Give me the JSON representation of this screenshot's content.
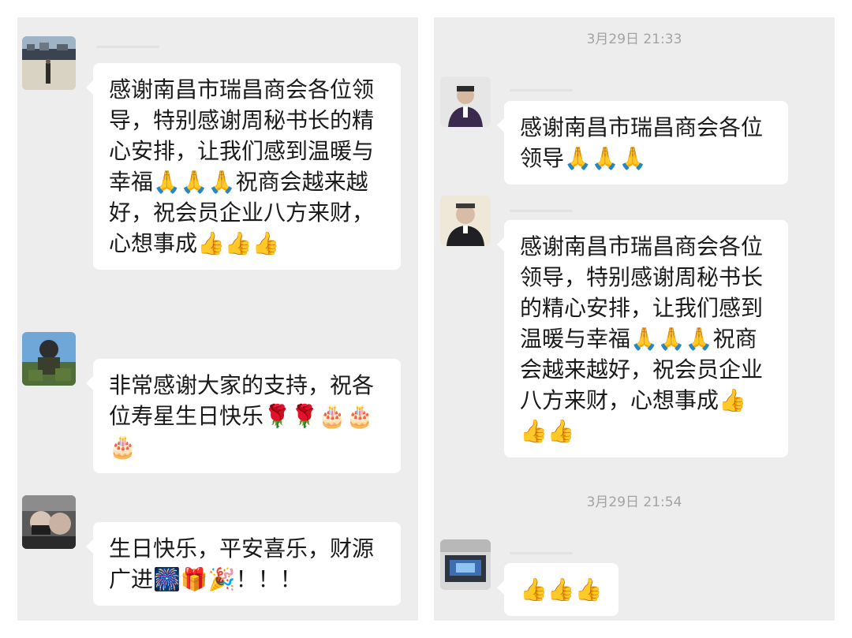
{
  "left_panel": {
    "messages": [
      {
        "text": "感谢南昌市瑞昌商会各位领导，特别感谢周秘书长的精心安排，让我们感到温暖与幸福🙏🙏🙏祝商会越来越好，祝会员企业八方来财，心想事成👍👍👍"
      },
      {
        "text": "非常感谢大家的支持，祝各位寿星生日快乐🌹🌹🎂🎂🎂"
      },
      {
        "text": "生日快乐，平安喜乐，财源广进🎆🎁🎉！！！"
      }
    ]
  },
  "right_panel": {
    "timestamp_1": "3月29日 21:33",
    "timestamp_2": "3月29日 21:54",
    "messages": [
      {
        "text": "感谢南昌市瑞昌商会各位领导🙏🙏🙏"
      },
      {
        "text": "感谢南昌市瑞昌商会各位领导，特别感谢周秘书长的精心安排，让我们感到温暖与幸福🙏🙏🙏祝商会越来越好，祝会员企业八方来财，心想事成👍👍👍"
      },
      {
        "text": "👍👍👍"
      }
    ]
  },
  "colors": {
    "chat_background": "#ededed",
    "bubble_background": "#ffffff",
    "timestamp_text": "#a3a3a3"
  }
}
